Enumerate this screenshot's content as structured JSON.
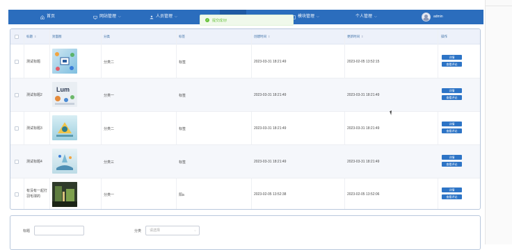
{
  "nav": {
    "home": "首页",
    "site_manage": "网站管理",
    "staff_manage": "人员管理",
    "module_manage": "模块管理",
    "personal_manage": "个人管理",
    "user_name": "admin"
  },
  "toast": {
    "message": "提交成功!"
  },
  "table": {
    "headers": {
      "title": "标题",
      "cover": "封面图",
      "category": "分类",
      "tag": "标签",
      "created": "创建时间",
      "updated": "更新时间",
      "actions": "操作"
    },
    "rows": [
      {
        "title": "测试标题",
        "category": "分类二",
        "tag": "标签",
        "created": "2023-03-31 18:21:49",
        "updated": "2023-02-05 13:52:15",
        "detail": "详情",
        "comment": "查看评论"
      },
      {
        "title": "测试标题2",
        "category": "分类一",
        "tag": "标签",
        "created": "2023-03-31 18:21:49",
        "updated": "2023-03-31 18:21:49",
        "detail": "详情",
        "comment": "查看评论"
      },
      {
        "title": "测试标题3",
        "category": "分类二",
        "tag": "标签",
        "created": "2023-03-31 18:21:49",
        "updated": "2023-03-31 18:21:49",
        "detail": "详情",
        "comment": "查看评论"
      },
      {
        "title": "测试标题4",
        "category": "分类三",
        "tag": "标签",
        "created": "2023-03-31 18:21:49",
        "updated": "2023-03-31 18:21:49",
        "detail": "详情",
        "comment": "查看评论"
      },
      {
        "title": "有没有一起打羽毛球的",
        "category": "分类一",
        "tag": "阳a",
        "created": "2023-02-05 13:52:38",
        "updated": "2023-02-05 13:52:06",
        "detail": "详情",
        "comment": "查看评论"
      }
    ]
  },
  "search": {
    "title_label": "标题",
    "category_label": "分类",
    "category_placeholder": "请选择"
  },
  "colors": {
    "header": "#2b6dbd",
    "table_header": "#edf1fa",
    "button": "#2d74c6",
    "toast_text": "#67c23a"
  }
}
